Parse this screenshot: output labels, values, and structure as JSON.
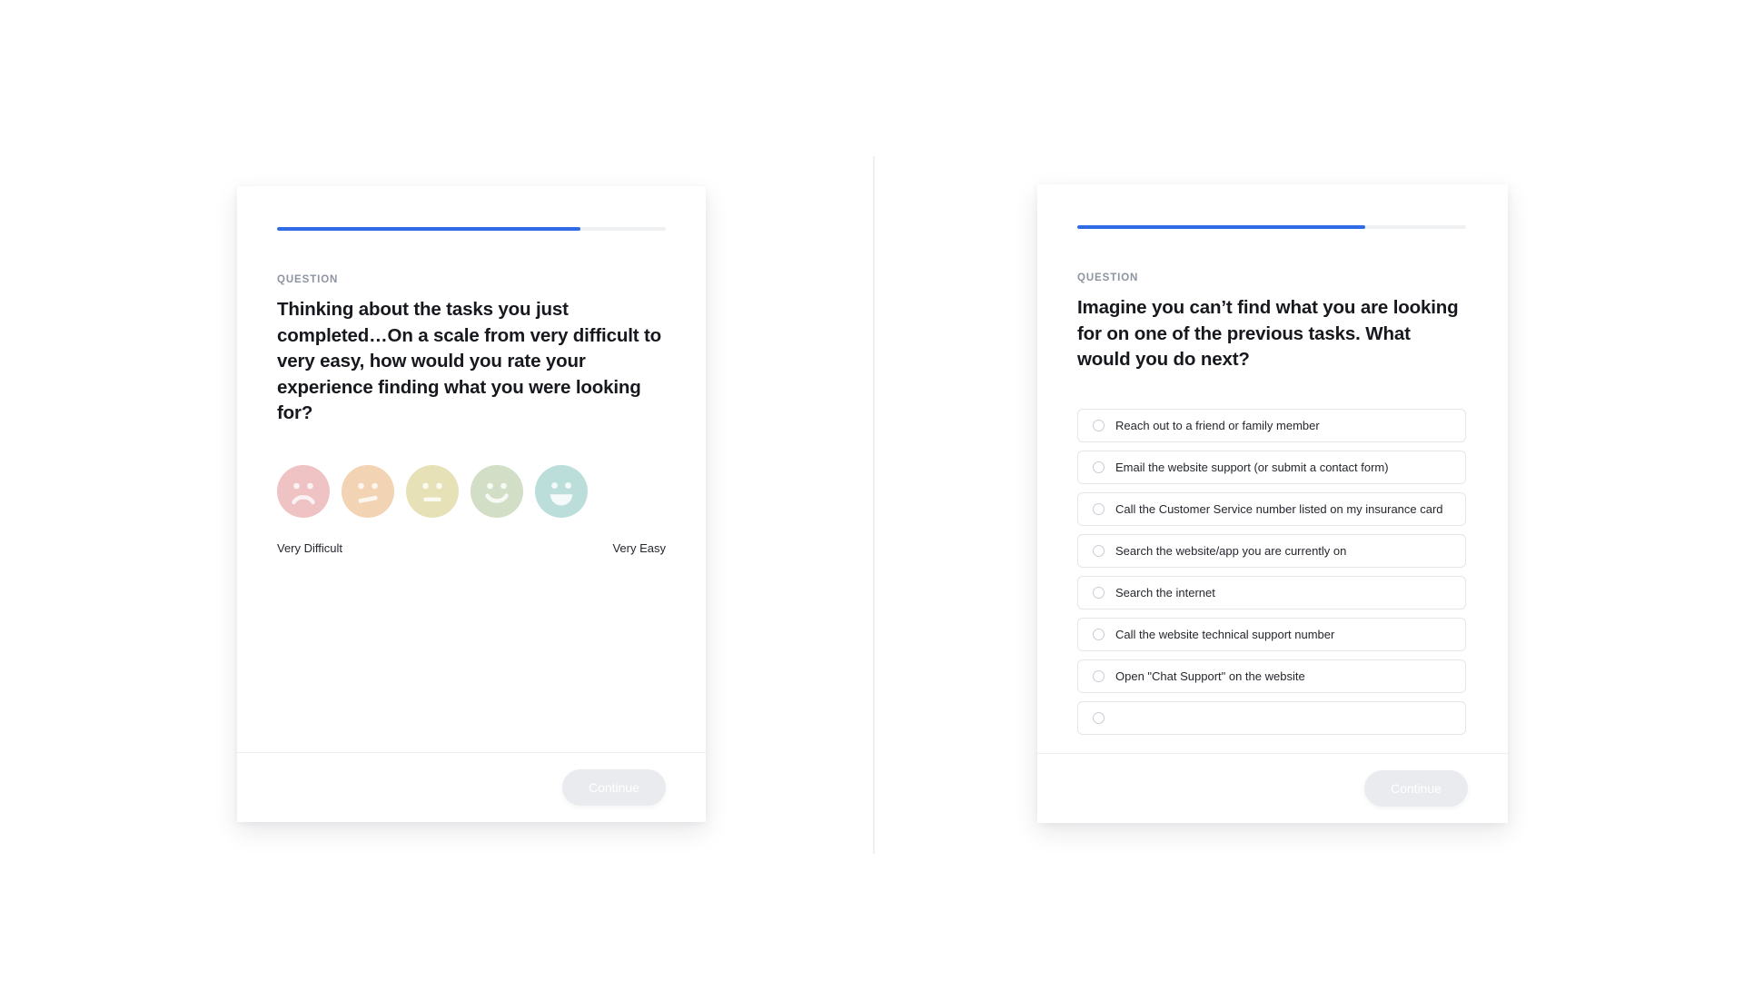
{
  "theme": {
    "accent_blue": "#2f6be4",
    "progress_track": "#eff0f1",
    "card_background": "#ffffff",
    "page_background": "#ffffff",
    "text_primary": "#16181d",
    "text_secondary": "#25272e",
    "eyebrow_color": "#8d93a1",
    "option_border": "#e4e6ea",
    "button_disabled_bg": "#e9ebef"
  },
  "left_card": {
    "progress": {
      "percent": 78,
      "label": "78%"
    },
    "eyebrow": "QUESTION",
    "question": "Thinking about the tasks you just completed…On a scale from very difficult to very easy, how would you rate your experience finding what you were looking for?",
    "scale": {
      "low_label": "Very Difficult",
      "high_label": "Very Easy",
      "faces": [
        {
          "value": 1,
          "name": "very-difficult",
          "expression": "frown",
          "color": "#efc2c4"
        },
        {
          "value": 2,
          "name": "difficult",
          "expression": "slight-frown",
          "color": "#f2d3b4"
        },
        {
          "value": 3,
          "name": "neutral",
          "expression": "neutral",
          "color": "#e7e1b7"
        },
        {
          "value": 4,
          "name": "easy",
          "expression": "smile",
          "color": "#d2dec5"
        },
        {
          "value": 5,
          "name": "very-easy",
          "expression": "big-smile",
          "color": "#bcdedb"
        }
      ]
    },
    "footer": {
      "continue_label": "Continue"
    }
  },
  "right_card": {
    "progress": {
      "percent": 74,
      "label": "74%"
    },
    "eyebrow": "QUESTION",
    "question": "Imagine you can’t find what you are looking for on one of the previous tasks. What would you do next?",
    "options": [
      {
        "label": "Reach out to a friend or family member",
        "selected": false
      },
      {
        "label": "Email the website support (or submit a contact form)",
        "selected": false
      },
      {
        "label": "Call the Customer Service number listed on my insurance card",
        "selected": false
      },
      {
        "label": "Search the website/app you are currently on",
        "selected": false
      },
      {
        "label": "Search the internet",
        "selected": false
      },
      {
        "label": "Call the website technical support number",
        "selected": false
      },
      {
        "label": "Open \"Chat Support\" on the website",
        "selected": false
      },
      {
        "label": "",
        "selected": false
      }
    ],
    "footer": {
      "continue_label": "Continue"
    }
  }
}
